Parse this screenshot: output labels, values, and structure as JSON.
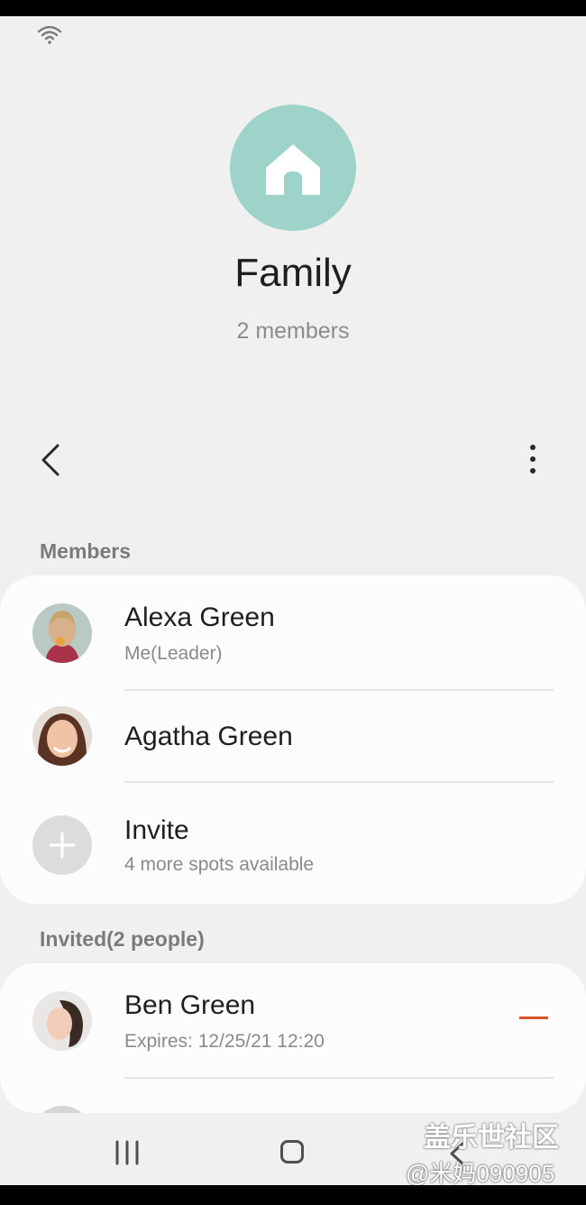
{
  "group": {
    "icon": "home-icon",
    "icon_color": "#9dd3c8",
    "title": "Family",
    "subtitle": "2 members"
  },
  "toolbar": {
    "back_icon": "chevron-left-icon",
    "more_icon": "more-vertical-icon"
  },
  "members_section": {
    "label": "Members",
    "items": [
      {
        "name": "Alexa Green",
        "sub": "Me(Leader)"
      },
      {
        "name": "Agatha Green",
        "sub": ""
      }
    ],
    "invite": {
      "name": "Invite",
      "sub": "4 more spots available",
      "icon": "plus-icon"
    }
  },
  "invited_section": {
    "label": "Invited(2 people)",
    "items": [
      {
        "name": "Ben Green",
        "sub": "Expires:  12/25/21 12:20",
        "remove_icon": "minus-icon"
      }
    ],
    "remove_color": "#d9542b"
  },
  "navbar": {
    "recents_icon": "recents-icon",
    "home_icon": "home-button-icon",
    "back_icon": "back-icon"
  },
  "watermark": {
    "line1": "盖乐世社区",
    "line2": "@米妈090905"
  }
}
